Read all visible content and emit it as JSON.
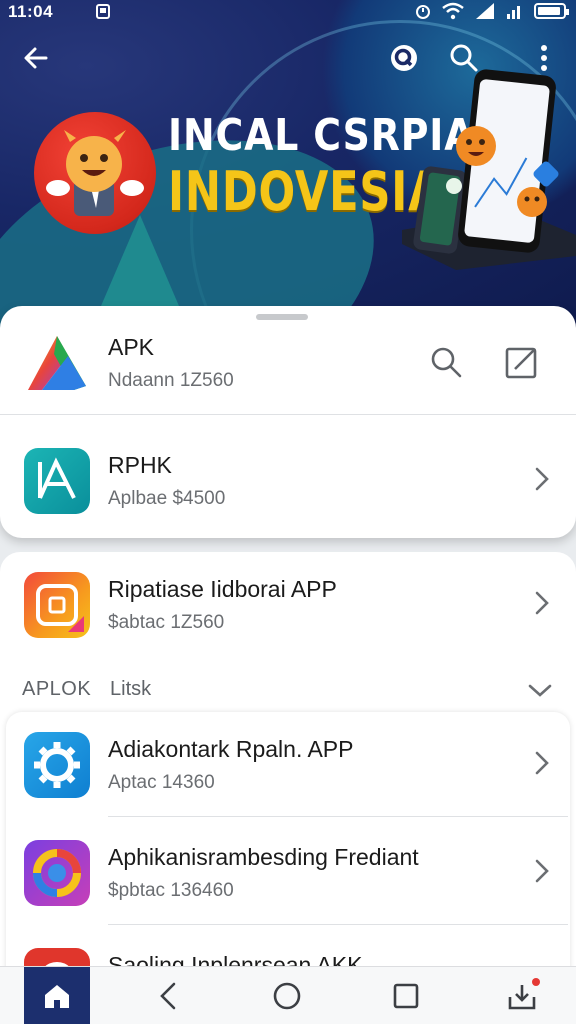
{
  "status_bar": {
    "time": "11:04"
  },
  "banner": {
    "title_line1": "INCAL CSRPIA",
    "title_line2": "INDOVESIA"
  },
  "top_card": {
    "app": {
      "title": "APK",
      "subtitle": "Ndaann 1Z560"
    },
    "row2": {
      "title": "RPHK",
      "subtitle": "Aplbae $4500"
    }
  },
  "featured": {
    "title": "Ripatiase Iidborai APP",
    "subtitle": "$abtac 1Z560"
  },
  "section": {
    "label": "APLOK",
    "label2": "Litsk"
  },
  "list": [
    {
      "title": "Adiakontark Rpaln. APP",
      "subtitle": "Aptac 14360"
    },
    {
      "title": "Aphikanisrambesding Frediant",
      "subtitle": "$pbtac 136460"
    },
    {
      "title": "Saoling Inplenrsean AKK",
      "subtitle": ""
    }
  ],
  "colors": {
    "banner_bg": "#182766",
    "title_yellow": "#f5c518",
    "nav_active": "#1c2f6e",
    "notification_dot": "#e53935"
  },
  "icons": {
    "back": "arrow-left-icon",
    "q_badge": "q-icon",
    "search": "search-icon",
    "more": "more-vert-icon",
    "edit": "edit-icon",
    "chevron": "chevron-right-icon",
    "home": "home-icon",
    "nav_back": "nav-back-icon",
    "nav_home": "circle-icon",
    "nav_recents": "square-icon",
    "download": "download-icon"
  }
}
